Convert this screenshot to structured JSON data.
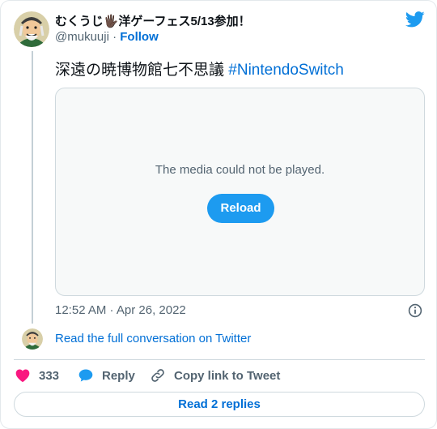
{
  "author": {
    "display_name": "むくうじ🖐🏿洋ゲーフェス5/13参加！",
    "handle": "@mukuuji",
    "separator": "·",
    "follow_label": "Follow"
  },
  "tweet": {
    "text": "深遠の暁博物館七不思議 ",
    "hashtag": "#NintendoSwitch",
    "timestamp": "12:52 AM · Apr 26, 2022"
  },
  "media": {
    "message": "The media could not be played.",
    "reload_label": "Reload"
  },
  "conversation": {
    "read_full_label": "Read the full conversation on Twitter"
  },
  "actions": {
    "like_count": "333",
    "reply_label": "Reply",
    "copy_label": "Copy link to Tweet"
  },
  "footer": {
    "read_replies_label": "Read 2 replies"
  },
  "colors": {
    "brand_blue": "#1d9bf0",
    "link_blue": "#006fd6",
    "like_red": "#f91880",
    "muted_text": "#536471"
  },
  "icons": {
    "brand": "twitter-bird-icon",
    "info": "info-icon",
    "like": "heart-icon",
    "reply": "speech-bubble-icon",
    "copy": "link-icon"
  }
}
